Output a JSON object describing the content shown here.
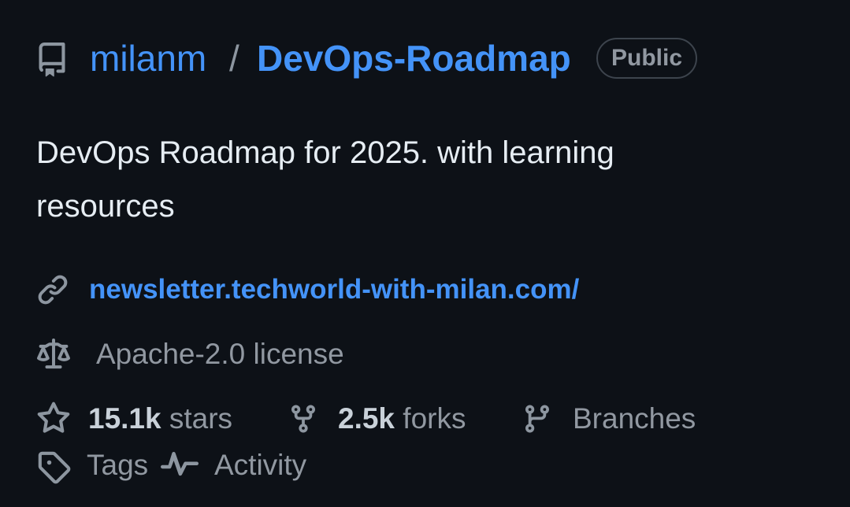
{
  "repo": {
    "owner": "milanm",
    "separator": "/",
    "name": "DevOps-Roadmap",
    "visibility": "Public",
    "icon": "repo-icon"
  },
  "description": "DevOps Roadmap for 2025. with learning resources",
  "website": {
    "url_text": "newsletter.techworld-with-milan.com/",
    "icon": "link-icon"
  },
  "license": {
    "text": "Apache-2.0 license",
    "icon": "law-icon"
  },
  "stats": {
    "stars": {
      "count": "15.1k",
      "label": "stars",
      "icon": "star-icon"
    },
    "forks": {
      "count": "2.5k",
      "label": "forks",
      "icon": "repo-forked-icon"
    },
    "branches": {
      "label": "Branches",
      "icon": "git-branch-icon"
    },
    "tags": {
      "label": "Tags",
      "icon": "tag-icon"
    },
    "activity": {
      "label": "Activity",
      "icon": "pulse-icon"
    }
  },
  "colors": {
    "background": "#0d1117",
    "link": "#4493f8",
    "text": "#e6edf3",
    "muted": "#9198a1"
  }
}
